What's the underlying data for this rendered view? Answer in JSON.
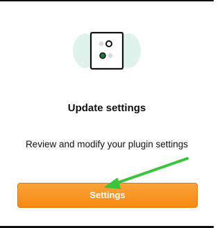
{
  "card": {
    "icon": "settings-toggles-icon",
    "title": "Update settings",
    "description": "Review and modify your plugin settings",
    "button_label": "Settings"
  },
  "annotation": {
    "icon": "arrow-pointer-icon",
    "color": "#3cc33c"
  },
  "colors": {
    "button": "#f7941d",
    "illustration_bg": "#d9f1ea",
    "dot_active": "#1a7a3a"
  }
}
